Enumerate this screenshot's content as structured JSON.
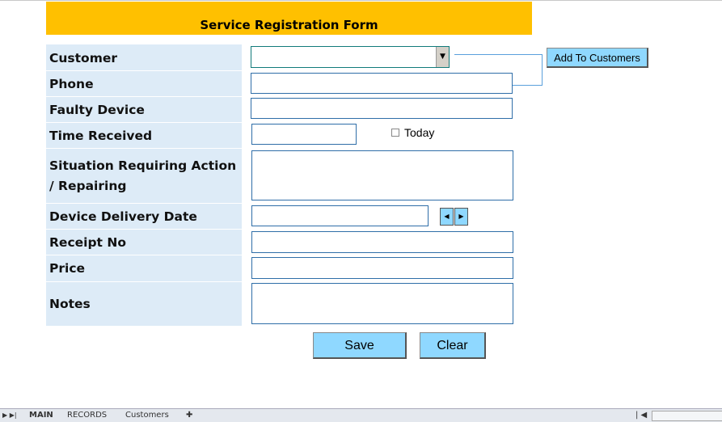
{
  "title": "Service Registration Form",
  "labels": {
    "customer": "Customer",
    "phone": "Phone",
    "faulty_device": "Faulty Device",
    "time_received": "Time Received",
    "situation_1": "Situation Requiring Action",
    "situation_2": "/ Repairing",
    "delivery_date": "Device Delivery Date",
    "receipt_no": "Receipt No",
    "price": "Price",
    "notes": "Notes"
  },
  "buttons": {
    "add_customers": "Add To Customers",
    "save": "Save",
    "clear": "Clear"
  },
  "today_label": "Today",
  "sheet_tabs": [
    "MAIN",
    "RECORDS",
    "Customers"
  ],
  "colors": {
    "header": "#ffc000",
    "label_bg": "#ddebf7",
    "button": "#8fd8ff"
  }
}
